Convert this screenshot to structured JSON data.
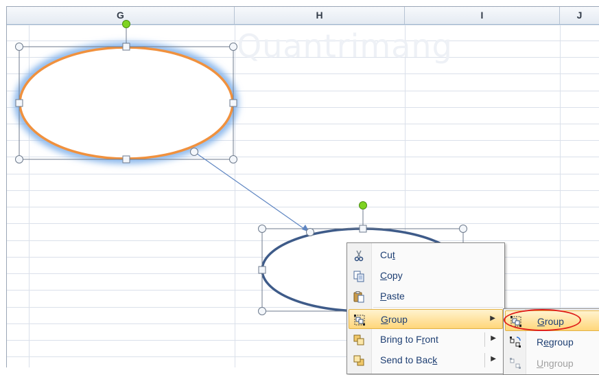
{
  "columns": [
    {
      "id": "col-g",
      "label": "G"
    },
    {
      "id": "col-h",
      "label": "H"
    },
    {
      "id": "col-i",
      "label": "I"
    },
    {
      "id": "col-j",
      "label": "J"
    }
  ],
  "watermark": "Quantrimang",
  "context_menu": {
    "items": [
      {
        "label": "Cut",
        "accel": "t",
        "icon": "scissors-icon"
      },
      {
        "label": "Copy",
        "accel": "C",
        "icon": "copy-icon"
      },
      {
        "label": "Paste",
        "accel": "P",
        "icon": "paste-icon"
      },
      {
        "label": "Group",
        "accel": "G",
        "icon": "group-icon",
        "submenu": true,
        "highlighted": true
      },
      {
        "label": "Bring to Front",
        "accel": "r",
        "icon": "bring-to-front-icon",
        "submenu": true
      },
      {
        "label": "Send to Back",
        "accel": "k",
        "icon": "send-to-back-icon",
        "submenu": true
      }
    ]
  },
  "group_submenu": {
    "items": [
      {
        "label": "Group",
        "accel": "G",
        "icon": "group-icon",
        "highlighted": true
      },
      {
        "label": "Regroup",
        "accel": "e",
        "icon": "regroup-icon"
      },
      {
        "label": "Ungroup",
        "accel": "U",
        "icon": "ungroup-icon",
        "disabled": true
      }
    ]
  },
  "colors": {
    "ellipse_top_stroke": "#f0913e",
    "ellipse_top_glow": "#7fb0ea",
    "ellipse_bottom_stroke": "#3e5b89",
    "connector": "#5f86c2",
    "rotate_handle": "#7ed321",
    "menu_highlight": "#ffd67a",
    "annotation_circle": "#e0201b"
  }
}
